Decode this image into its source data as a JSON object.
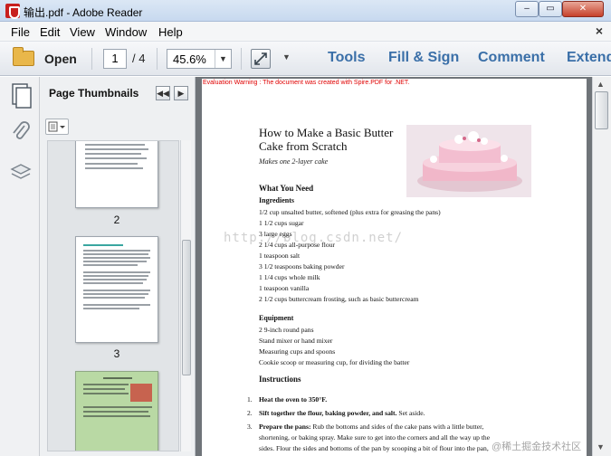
{
  "window": {
    "title": "输出.pdf - Adobe Reader",
    "min_glyph": "–",
    "max_glyph": "▭",
    "close_glyph": "✕"
  },
  "menu": {
    "items": [
      "File",
      "Edit",
      "View",
      "Window",
      "Help"
    ],
    "close_glyph": "×"
  },
  "toolbar": {
    "open_label": "Open",
    "page_current": "1",
    "page_total": "/ 4",
    "zoom_value": "45.6%",
    "zoom_arrow": "▼",
    "fit_dropdown": "▼",
    "links": [
      "Tools",
      "Fill & Sign",
      "Comment",
      "Extend"
    ]
  },
  "thumbnails": {
    "title": "Page Thumbnails",
    "prev_glyph": "◀◀",
    "next_glyph": "▶",
    "pages": [
      {
        "number": "2"
      },
      {
        "number": "3"
      }
    ]
  },
  "document": {
    "eval_warning": "Evaluation Warning : The document was created with Spire.PDF for .NET.",
    "title": "How to Make a Basic Butter Cake from Scratch",
    "subtitle": "Makes one 2-layer cake",
    "what_you_need": "What You Need",
    "ingredients_label": "Ingredients",
    "ingredients": [
      "1/2 cup unsalted butter, softened (plus extra for greasing the pans)",
      "1 1/2 cups sugar",
      "3 large eggs",
      "2 1/4 cups all-purpose flour",
      "1 teaspoon salt",
      "3 1/2 teaspoons baking powder",
      "1 1/4 cups whole milk",
      "1 teaspoon vanilla",
      "2 1/2 cups buttercream frosting, such as basic buttercream"
    ],
    "equipment_label": "Equipment",
    "equipment": [
      "2 9-inch round pans",
      "Stand mixer or hand mixer",
      "Measuring cups and spoons",
      "Cookie scoop or measuring cup, for dividing the batter"
    ],
    "instructions_label": "Instructions",
    "steps": [
      {
        "num": "1.",
        "bold": "Heat the oven to 350°F.",
        "rest": ""
      },
      {
        "num": "2.",
        "bold": "Sift together the flour, baking powder, and salt.",
        "rest": " Set aside."
      },
      {
        "num": "3.",
        "bold": "Prepare the pans:",
        "rest": " Rub the bottoms and sides of the cake pans with a little butter,"
      },
      {
        "num": "",
        "bold": "",
        "rest": "shortening, or baking spray. Make sure to get into the corners and all the way up the"
      },
      {
        "num": "",
        "bold": "",
        "rest": "sides. Flour the sides and bottoms of the pan by scooping a bit of flour into the pan,"
      }
    ],
    "watermark": "http://blog.csdn.net/",
    "corner_mark": "@稀土掘金技术社区"
  },
  "scrollbar": {
    "up_glyph": "▲",
    "down_glyph": "▼"
  }
}
